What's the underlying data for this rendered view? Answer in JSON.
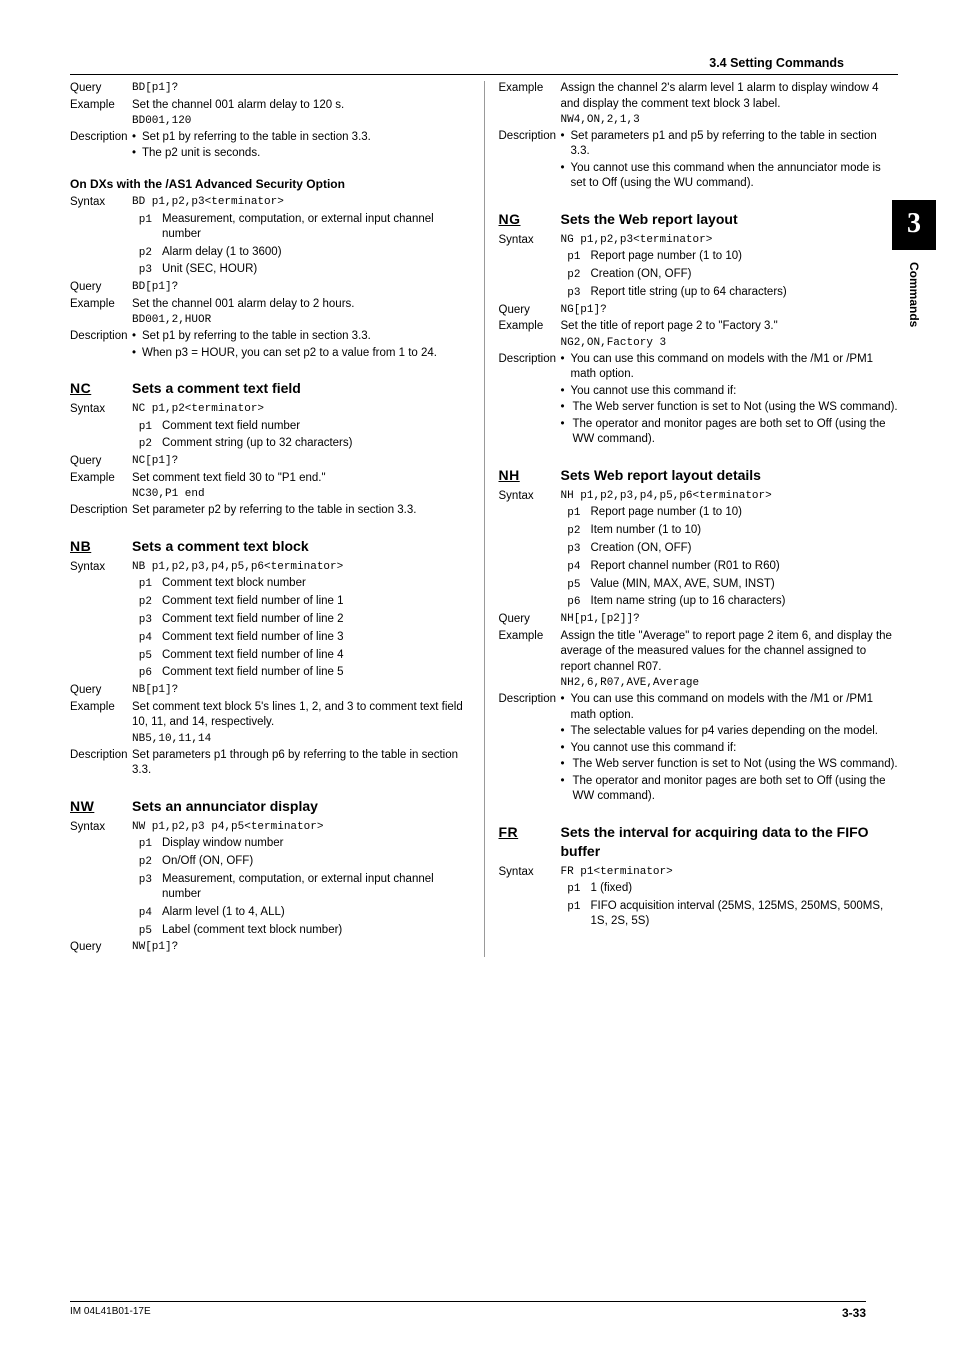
{
  "header": {
    "section": "3.4  Setting Commands"
  },
  "sidetab": {
    "num": "3",
    "text": "Commands"
  },
  "footer": {
    "left": "IM 04L41B01-17E",
    "right": "3-33"
  },
  "left": {
    "bd": {
      "q_label": "Query",
      "q": "BD[p1]?",
      "ex_label": "Example",
      "ex1": "Set the channel 001 alarm delay to 120 s.",
      "ex2": "BD001,120",
      "desc_label": "Description",
      "d1": "Set p1 by referring to the table in section 3.3.",
      "d2": "The p2 unit is seconds."
    },
    "as1": {
      "heading": "On DXs with the /AS1 Advanced Security Option",
      "syn_label": "Syntax",
      "syn": "BD p1,p2,p3<terminator>",
      "p1": "Measurement, computation, or external input channel number",
      "p2": "Alarm delay (1 to 3600)",
      "p3": "Unit (SEC, HOUR)",
      "q_label": "Query",
      "q": "BD[p1]?",
      "ex_label": "Example",
      "ex1": "Set the channel 001 alarm delay to 2 hours.",
      "ex2": "BD001,2,HUOR",
      "desc_label": "Description",
      "d1": "Set p1 by referring to the table in section 3.3.",
      "d2": "When p3 = HOUR, you can set p2 to a value from 1 to 24."
    },
    "nc": {
      "code": "NC",
      "title": "Sets a comment text field",
      "syn_label": "Syntax",
      "syn": "NC p1,p2<terminator>",
      "p1": "Comment text field number",
      "p2": "Comment string (up to 32 characters)",
      "q_label": "Query",
      "q": "NC[p1]?",
      "ex_label": "Example",
      "ex1": "Set comment text field 30 to \"P1 end.\"",
      "ex2": "NC30,P1 end",
      "desc_label": "Description",
      "desc": "Set parameter p2 by referring to the table in section 3.3."
    },
    "nb": {
      "code": "NB",
      "title": "Sets a comment text block",
      "syn_label": "Syntax",
      "syn": "NB p1,p2,p3,p4,p5,p6<terminator>",
      "p1": "Comment text block number",
      "p2": "Comment text field number of line 1",
      "p3": "Comment text field number of line 2",
      "p4": "Comment text field number of line 3",
      "p5": "Comment text field number of line 4",
      "p6": "Comment text field number of line 5",
      "q_label": "Query",
      "q": "NB[p1]?",
      "ex_label": "Example",
      "ex1": "Set comment text block 5's lines 1, 2, and 3 to comment text field 10, 11, and 14, respectively.",
      "ex2": "NB5,10,11,14",
      "desc_label": "Description",
      "desc": "Set parameters p1 through p6 by referring to the table in section 3.3."
    },
    "nw": {
      "code": "NW",
      "title": "Sets an annunciator display",
      "syn_label": "Syntax",
      "syn": "NW p1,p2,p3 p4,p5<terminator>",
      "p1": "Display window number",
      "p2": "On/Off (ON, OFF)",
      "p3": "Measurement, computation, or external input channel number",
      "p4": "Alarm level (1 to 4, ALL)",
      "p5": "Label (comment text block number)",
      "q_label": "Query",
      "q": "NW[p1]?"
    }
  },
  "right": {
    "nw_cont": {
      "ex_label": "Example",
      "ex1": "Assign the channel 2's alarm level 1 alarm to display window 4 and display the comment text block 3 label.",
      "ex2": "NW4,ON,2,1,3",
      "desc_label": "Description",
      "d1": "Set parameters p1 and p5 by referring to the table in section 3.3.",
      "d2": "You cannot use this command when the annunciator mode is set to Off (using the WU command)."
    },
    "ng": {
      "code": "NG",
      "title": "Sets the Web report layout",
      "syn_label": "Syntax",
      "syn": "NG p1,p2,p3<terminator>",
      "p1": "Report page number (1 to 10)",
      "p2": "Creation (ON, OFF)",
      "p3": "Report title string (up to 64 characters)",
      "q_label": "Query",
      "q": "NG[p1]?",
      "ex_label": "Example",
      "ex1": "Set the title of report page 2 to \"Factory 3.\"",
      "ex2": "NG2,ON,Factory 3",
      "desc_label": "Description",
      "d1": "You can use this command on models with the /M1 or /PM1 math option.",
      "d2": "You cannot use this command if:",
      "d2a": "The Web server function is set to Not (using the WS command).",
      "d2b": "The operator and monitor pages are both set to Off (using the WW command)."
    },
    "nh": {
      "code": "NH",
      "title": "Sets Web report layout details",
      "syn_label": "Syntax",
      "syn": "NH p1,p2,p3,p4,p5,p6<terminator>",
      "p1": "Report page number (1 to 10)",
      "p2": "Item number (1 to 10)",
      "p3": "Creation (ON, OFF)",
      "p4": "Report channel number (R01 to R60)",
      "p5": "Value (MIN, MAX, AVE, SUM, INST)",
      "p6": "Item name string (up to 16 characters)",
      "q_label": "Query",
      "q": "NH[p1,[p2]]?",
      "ex_label": "Example",
      "ex1": "Assign the title \"Average\" to report page 2 item 6, and display the average of the measured values for the channel assigned to report channel R07.",
      "ex2": "NH2,6,R07,AVE,Average",
      "desc_label": "Description",
      "d1": "You can use this command on models with the /M1 or /PM1 math option.",
      "d2": "The selectable values for p4 varies depending on the model.",
      "d3": "You cannot use this command if:",
      "d3a": "The Web server function is set to Not (using the WS command).",
      "d3b": "The operator and monitor pages are both set to Off (using the WW command)."
    },
    "fr": {
      "code": "FR",
      "title": "Sets the interval for acquiring data to the FIFO buffer",
      "syn_label": "Syntax",
      "syn": "FR p1<terminator>",
      "p1a": "1 (fixed)",
      "p1b": "FIFO acquisition interval (25MS, 125MS, 250MS, 500MS, 1S, 2S, 5S)"
    }
  }
}
